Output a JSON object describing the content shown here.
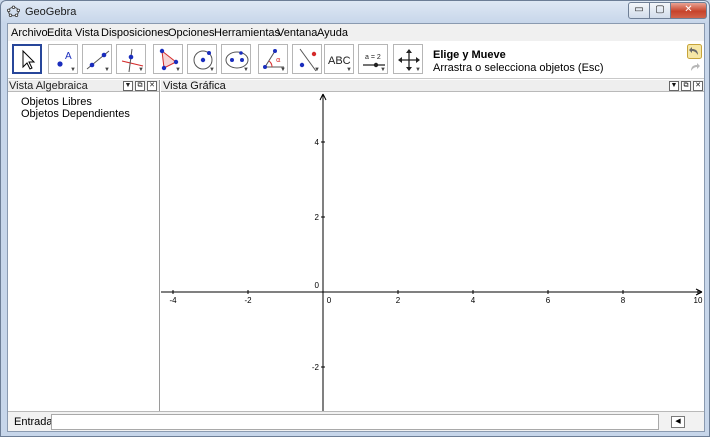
{
  "window": {
    "title": "GeoGebra",
    "min_glyph": "▭",
    "max_glyph": "▢",
    "close_glyph": "✕"
  },
  "menu": [
    "Archivo",
    "Edita",
    "Vista",
    "Disposiciones",
    "Opciones",
    "Herramientas",
    "Ventana",
    "Ayuda"
  ],
  "toolbar": {
    "tools": [
      {
        "icon": "pointer-icon",
        "selected": true
      },
      {
        "icon": "point-icon"
      },
      {
        "icon": "line-icon"
      },
      {
        "icon": "perpendicular-icon"
      },
      {
        "icon": "polygon-icon"
      },
      {
        "icon": "circle-icon"
      },
      {
        "icon": "ellipse-icon"
      },
      {
        "icon": "angle-icon"
      },
      {
        "icon": "reflect-icon"
      },
      {
        "icon": "text-icon",
        "label": "ABC"
      },
      {
        "icon": "slider-icon",
        "label": "a = 2"
      },
      {
        "icon": "move-view-icon"
      }
    ],
    "active_tool_title": "Elige y Mueve",
    "active_tool_help": "Arrastra o selecciona objetos (Esc)",
    "undo_icon": "undo-icon",
    "redo_icon": "redo-icon"
  },
  "algebra_view": {
    "title": "Vista Algebraica",
    "items": [
      "Objetos Libres",
      "Objetos Dependientes"
    ]
  },
  "graphics_view": {
    "title": "Vista Gráfica",
    "x_ticks": [
      "-4",
      "-2",
      "0",
      "2",
      "4",
      "6",
      "8",
      "10"
    ],
    "y_ticks": [
      "4",
      "2",
      "0",
      "-2"
    ]
  },
  "input_bar": {
    "label": "Entrada:",
    "value": "",
    "placeholder": ""
  },
  "colors": {
    "selected_border": "#27469a",
    "point_blue": "#1a2dbd",
    "accent_red": "#d42a2a"
  }
}
